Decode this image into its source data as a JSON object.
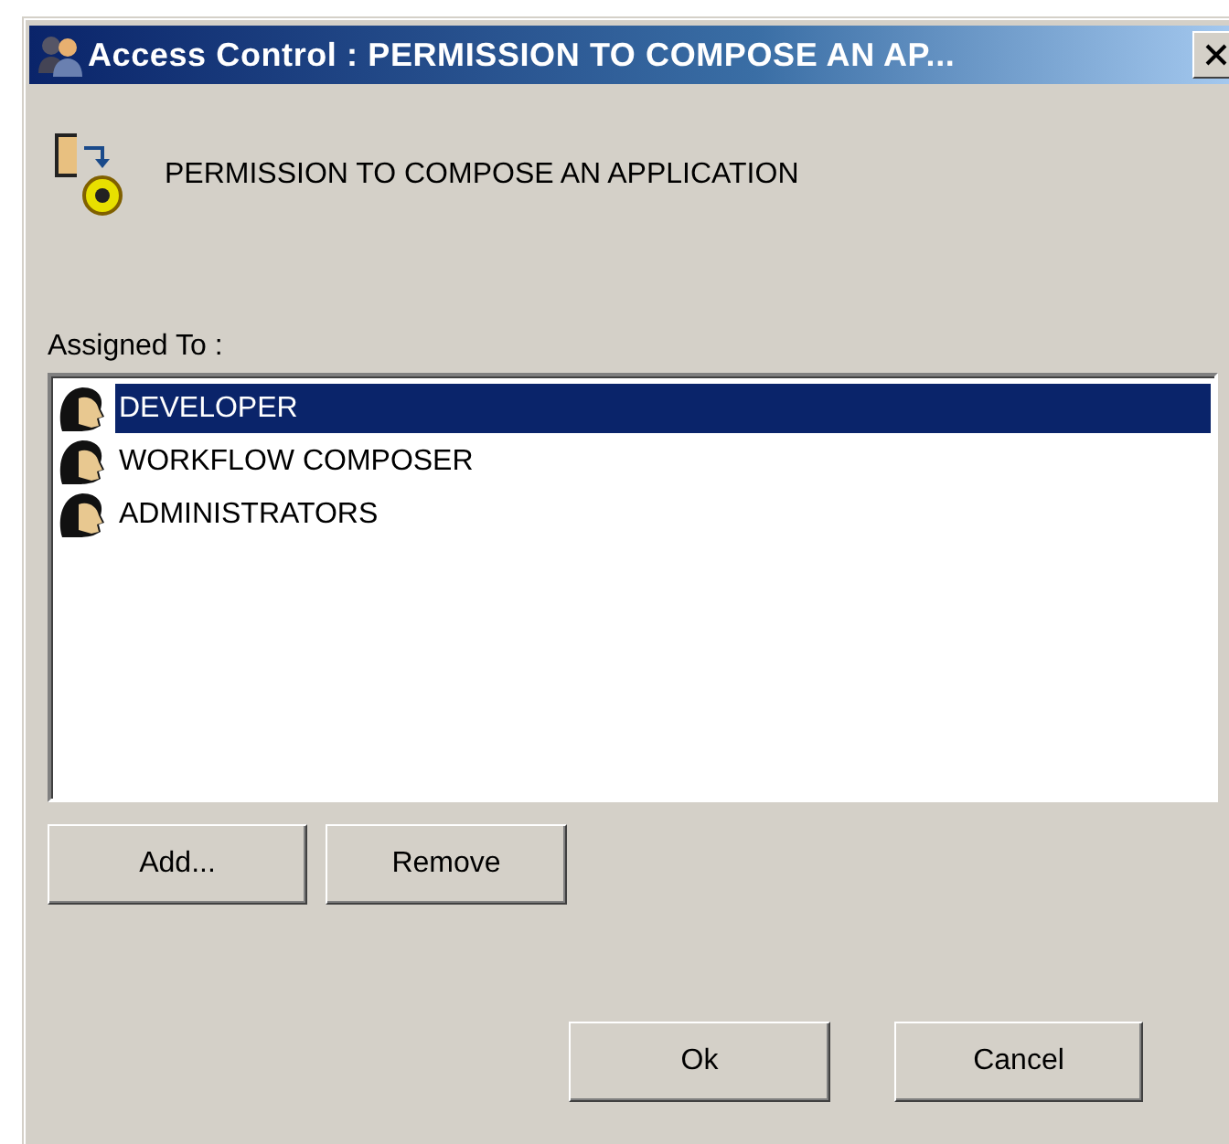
{
  "window": {
    "title": "Access Control : PERMISSION TO COMPOSE AN AP..."
  },
  "permission": {
    "name": "PERMISSION TO COMPOSE AN APPLICATION"
  },
  "assigned": {
    "label": "Assigned To :",
    "items": [
      {
        "name": "DEVELOPER",
        "selected": true
      },
      {
        "name": "WORKFLOW COMPOSER",
        "selected": false
      },
      {
        "name": "ADMINISTRATORS",
        "selected": false
      }
    ]
  },
  "list_buttons": [
    "Add...",
    "Remove"
  ],
  "dialog_buttons": [
    "Ok",
    "Cancel"
  ]
}
